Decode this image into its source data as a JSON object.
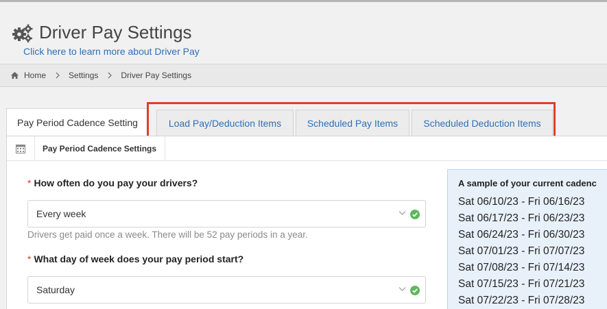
{
  "header": {
    "title": "Driver Pay Settings",
    "learn_link": "Click here to learn more about Driver Pay"
  },
  "breadcrumb": [
    "Home",
    "Settings",
    "Driver Pay Settings"
  ],
  "tabs": [
    {
      "label": "Pay Period Cadence Setting",
      "active": true
    },
    {
      "label": "Load Pay/Deduction Items",
      "active": false
    },
    {
      "label": "Scheduled Pay Items",
      "active": false
    },
    {
      "label": "Scheduled Deduction Items",
      "active": false
    }
  ],
  "panel": {
    "title": "Pay Period Cadence Settings",
    "q1": {
      "label": "How often do you pay your drivers?",
      "value": "Every week",
      "help": "Drivers get paid once a week. There will be 52 pay periods in a year."
    },
    "q2": {
      "label": "What day of week does your pay period start?",
      "value": "Saturday"
    },
    "required_mark": "*"
  },
  "sample": {
    "title": "A sample of your current cadenc",
    "rows": [
      "Sat 06/10/23 - Fri 06/16/23",
      "Sat 06/17/23 - Fri 06/23/23",
      "Sat 06/24/23 - Fri 06/30/23",
      "Sat 07/01/23 - Fri 07/07/23",
      "Sat 07/08/23 - Fri 07/14/23",
      "Sat 07/15/23 - Fri 07/21/23",
      "Sat 07/22/23 - Fri 07/28/23"
    ]
  },
  "colors": {
    "link": "#2f6eb5",
    "highlight": "#e03e28",
    "success": "#5cb85c",
    "required": "#d9352b"
  },
  "icons": [
    "gears-icon",
    "home-icon",
    "chevron-right-icon",
    "calendar-icon",
    "chevron-down-icon",
    "check-circle-icon"
  ]
}
